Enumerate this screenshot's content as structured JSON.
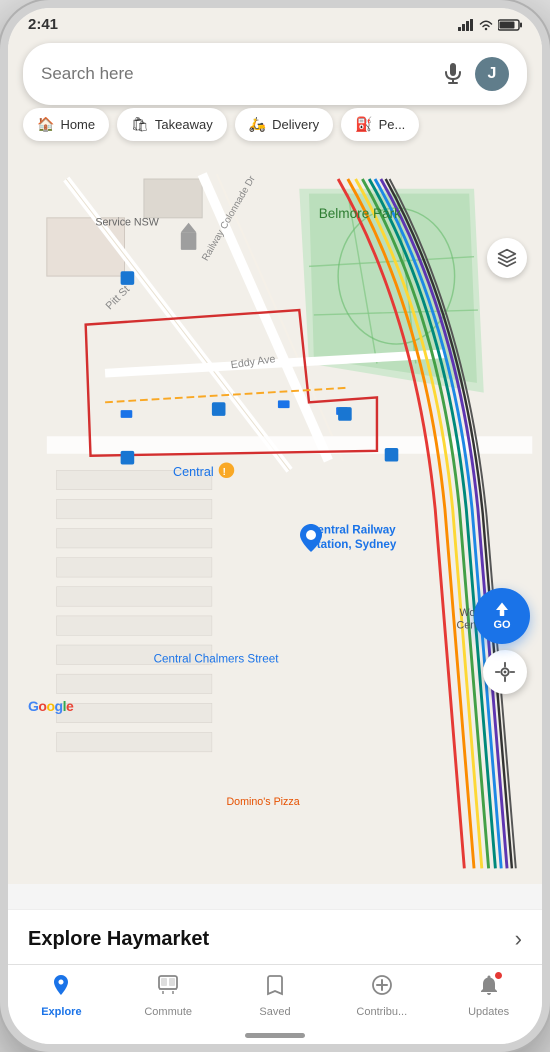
{
  "status_bar": {
    "time": "2:41",
    "icons": [
      "signal",
      "wifi",
      "battery"
    ]
  },
  "search": {
    "placeholder": "Search here",
    "mic_label": "microphone",
    "avatar_letter": "J"
  },
  "quick_actions": [
    {
      "id": "home",
      "icon": "🏠",
      "label": "Home"
    },
    {
      "id": "takeaway",
      "icon": "🛍",
      "label": "Takeaway"
    },
    {
      "id": "delivery",
      "icon": "🛵",
      "label": "Delivery"
    },
    {
      "id": "petrol",
      "icon": "⛽",
      "label": "Pe..."
    }
  ],
  "map": {
    "labels": {
      "belmore_park": "Belmore Park",
      "service_nsw": "Service NSW",
      "pitt_st": "Pitt St",
      "eddy_ave": "Eddy Ave",
      "railway_colonnade": "Railway Colonnade Dr",
      "central": "Central",
      "central_railway": "Central Railway\nStation, Sydney",
      "central_chalmers": "Central Chalmers Street",
      "woolw": "Woolw\nCen...(M",
      "dominos": "Domino's Pizza"
    },
    "buttons": {
      "layers": "layers",
      "location": "my-location",
      "go": "GO"
    }
  },
  "explore_bar": {
    "title": "Explore Haymarket",
    "chevron": "›"
  },
  "bottom_nav": [
    {
      "id": "explore",
      "icon": "📍",
      "label": "Explore",
      "active": true
    },
    {
      "id": "commute",
      "icon": "🏢",
      "label": "Commute",
      "active": false
    },
    {
      "id": "saved",
      "icon": "🔖",
      "label": "Saved",
      "active": false
    },
    {
      "id": "contribute",
      "icon": "➕",
      "label": "Contribu...",
      "active": false
    },
    {
      "id": "updates",
      "icon": "🔔",
      "label": "Updates",
      "active": false
    }
  ],
  "google_logo": [
    "G",
    "o",
    "o",
    "g",
    "l",
    "e"
  ]
}
